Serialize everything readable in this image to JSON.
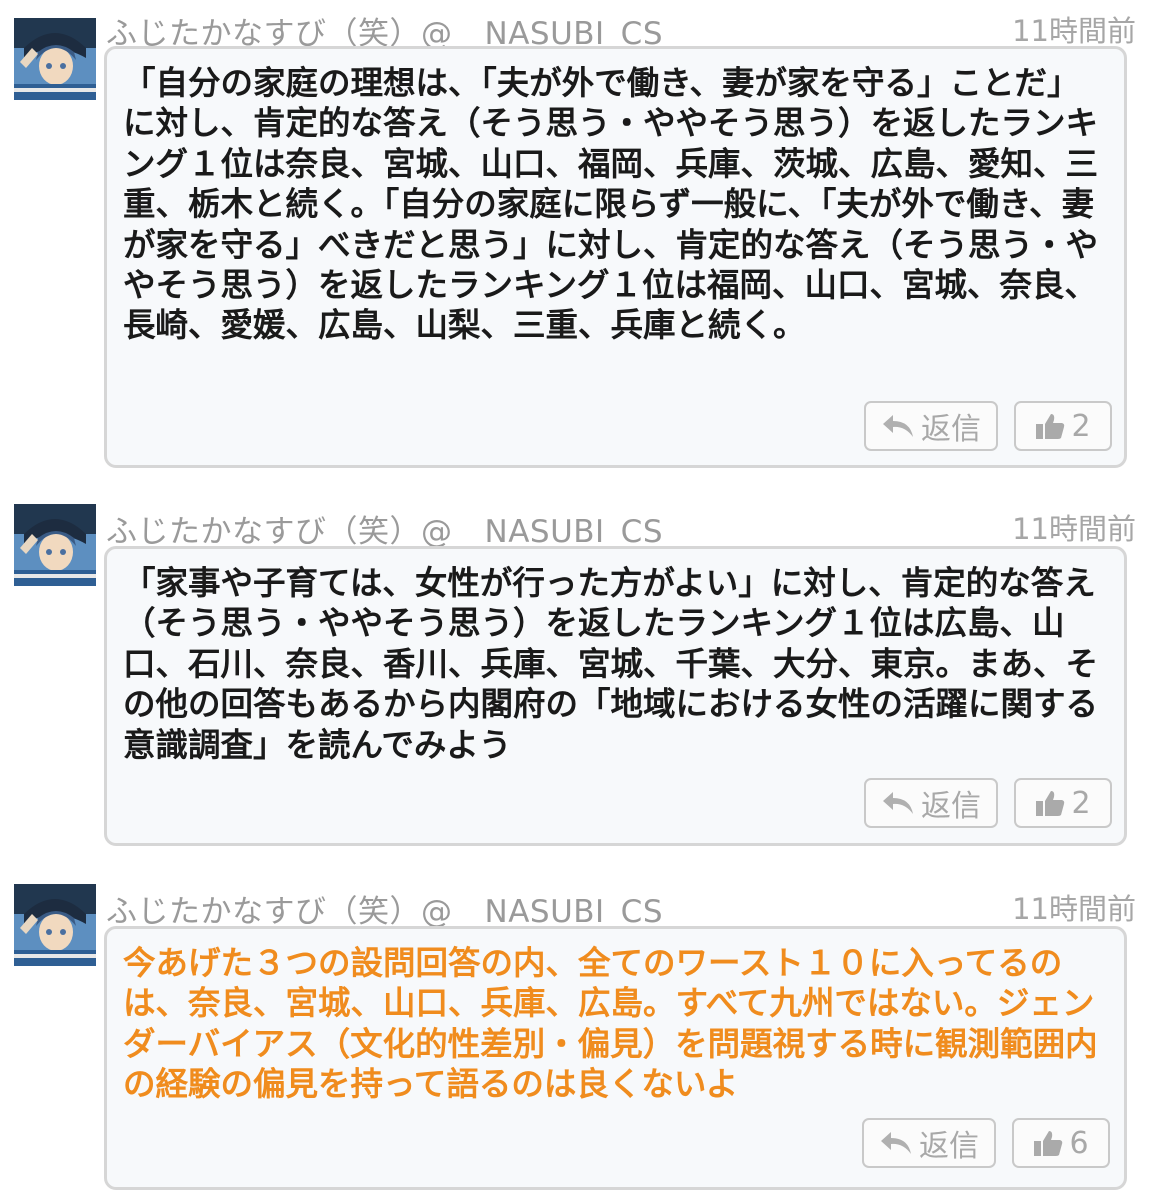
{
  "posts": [
    {
      "user_name": "ふじたかなすび（笑）@__NASUBI_CS__",
      "timestamp": "11時間前",
      "body": "「自分の家庭の理想は、「夫が外で働き、妻が家を守る」ことだ」に対し、肯定的な答え（そう思う・ややそう思う）を返したランキング１位は奈良、宮城、山口、福岡、兵庫、茨城、広島、愛知、三重、栃木と続く。「自分の家庭に限らず一般に、「夫が外で働き、妻が家を守る」べきだと思う」に対し、肯定的な答え（そう思う・ややそう思う）を返したランキング１位は福岡、山口、宮城、奈良、長崎、愛媛、広島、山梨、三重、兵庫と続く。",
      "reply_label": "返信",
      "like_count": "2",
      "text_color": "#1a1a1a"
    },
    {
      "user_name": "ふじたかなすび（笑）@__NASUBI_CS__",
      "timestamp": "11時間前",
      "body": "「家事や子育ては、女性が行った方がよい」に対し、肯定的な答え（そう思う・ややそう思う）を返したランキング１位は広島、山口、石川、奈良、香川、兵庫、宮城、千葉、大分、東京。まあ、その他の回答もあるから内閣府の「地域における女性の活躍に関する意識調査」を読んでみよう",
      "reply_label": "返信",
      "like_count": "2",
      "text_color": "#1a1a1a"
    },
    {
      "user_name": "ふじたかなすび（笑）@__NASUBI_CS__",
      "timestamp": "11時間前",
      "body": "今あげた３つの設問回答の内、全てのワースト１０に入ってるのは、奈良、宮城、山口、兵庫、広島。すべて九州ではない。ジェンダーバイアス（文化的性差別・偏見）を問題視する時に観測範囲内の経験の偏見を持って語るのは良くないよ",
      "reply_label": "返信",
      "like_count": "6",
      "text_color": "#f08c1e"
    }
  ],
  "icons": {
    "avatar": "avatar",
    "reply": "reply-arrow-icon",
    "like": "thumbs-up-icon"
  },
  "colors": {
    "meta_gray": "#9a9a9a",
    "bubble_bg": "#f7f9fb",
    "bubble_border": "#d6d6d6",
    "highlight_orange": "#f08c1e"
  }
}
